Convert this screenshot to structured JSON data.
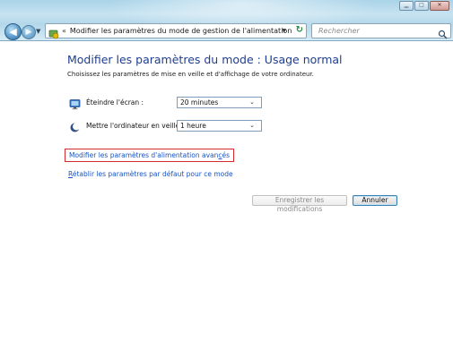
{
  "window": {
    "controls": [
      "minimize",
      "maximize",
      "close"
    ]
  },
  "nav": {
    "address_separator": "«",
    "address_text": "Modifier les paramètres du mode de gestion de l'alimentation",
    "search_placeholder": "Rechercher"
  },
  "main": {
    "title": "Modifier les paramètres du mode : Usage normal",
    "subtitle": "Choisissez les paramètres de mise en veille et d'affichage de votre ordinateur.",
    "settings": [
      {
        "label": "Éteindre l'écran :",
        "value": "20 minutes",
        "icon": "monitor-icon"
      },
      {
        "label": "Mettre l'ordinateur en veille :",
        "value": "1 heure",
        "icon": "moon-icon"
      }
    ],
    "advanced_link_pre": "Modifier les paramètres d'alimentation avan",
    "advanced_link_u": "c",
    "advanced_link_post": "és",
    "reset_link_u": "R",
    "reset_link_rest": "établir les paramètres par défaut pour ce mode",
    "save_label": "Enregistrer les modifications",
    "cancel_label": "Annuler"
  },
  "colors": {
    "title": "#1e3d8f",
    "link": "#1a55c0",
    "highlight_border": "#d62b2b"
  }
}
